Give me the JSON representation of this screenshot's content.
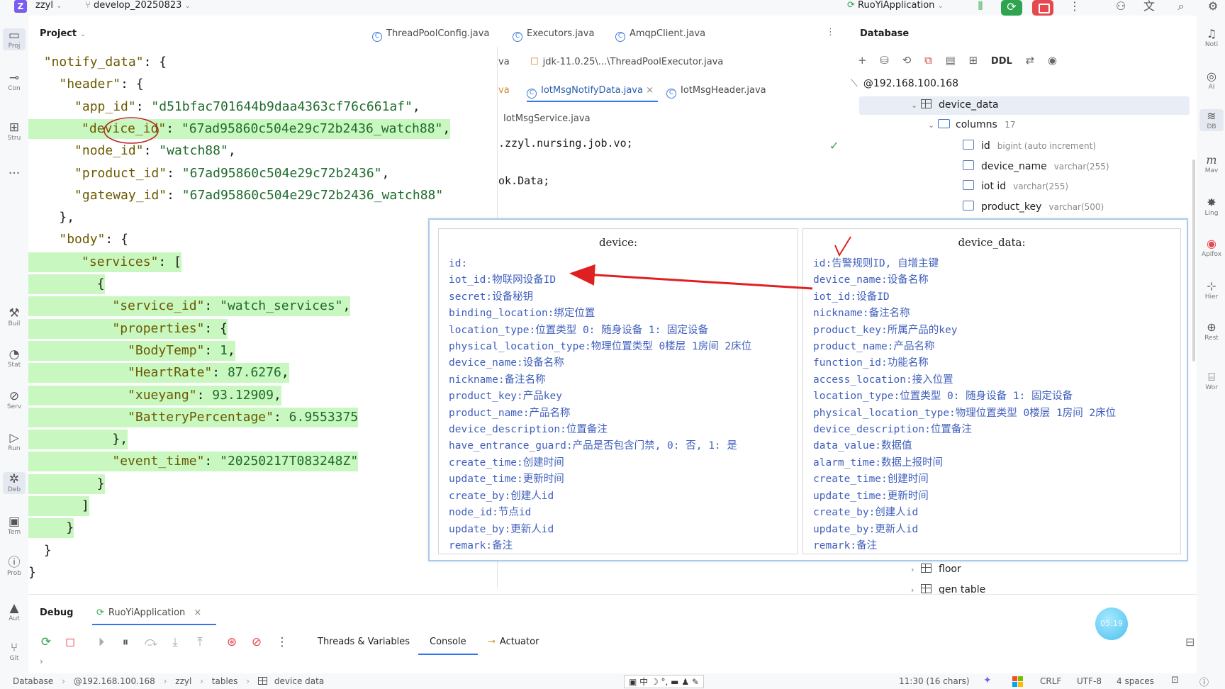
{
  "topbar": {
    "project_badge": "Z",
    "project_name": "zzyl",
    "branch": "develop_20250823",
    "run_config": "RuoYiApplication",
    "icons": [
      "branch-icon",
      "run-config-icon",
      "debug-icon",
      "run-icon",
      "stop-icon",
      "more-icon",
      "add-user-icon",
      "translate-icon",
      "search-icon",
      "settings-icon"
    ]
  },
  "left_strip": [
    {
      "label": "Proj",
      "icon": "folder-icon",
      "glyph": "▭"
    },
    {
      "label": "Con",
      "icon": "commit-icon",
      "glyph": "⊸"
    },
    {
      "label": "Stru",
      "icon": "structure-icon",
      "glyph": "⊞"
    },
    {
      "label": "...",
      "icon": "more-icon",
      "glyph": ""
    },
    {
      "label": "Buil",
      "icon": "build-icon",
      "glyph": "⚒"
    },
    {
      "label": "Stat",
      "icon": "stats-icon",
      "glyph": "◔"
    },
    {
      "label": "Serv",
      "icon": "services-icon",
      "glyph": "⊘"
    },
    {
      "label": "Run",
      "icon": "run-icon",
      "glyph": "▷"
    },
    {
      "label": "Deb",
      "icon": "debug-icon",
      "glyph": "✲"
    },
    {
      "label": "Tem",
      "icon": "terminal-icon",
      "glyph": "▣"
    },
    {
      "label": "Prob",
      "icon": "problems-icon",
      "glyph": "ⓘ"
    },
    {
      "label": "Aut",
      "icon": "warning-icon",
      "glyph": "▲"
    },
    {
      "label": "Git",
      "icon": "git-icon",
      "glyph": "⑂"
    }
  ],
  "right_strip": [
    {
      "label": "Noti",
      "icon": "notification-icon",
      "glyph": "♫"
    },
    {
      "label": "AI",
      "icon": "ai-icon",
      "glyph": "◎"
    },
    {
      "label": "DB",
      "icon": "database-icon",
      "glyph": "≋"
    },
    {
      "label": "Mav",
      "icon": "maven-icon",
      "glyph": "m"
    },
    {
      "label": "Ling",
      "icon": "lingma-icon",
      "glyph": "✸"
    },
    {
      "label": "Apifox",
      "icon": "apifox-icon",
      "glyph": "◉"
    },
    {
      "label": "Hier",
      "icon": "hierarchy-icon",
      "glyph": "⊹"
    },
    {
      "label": "Rest",
      "icon": "rest-icon",
      "glyph": "⊕"
    },
    {
      "label": "Wor",
      "icon": "word-icon",
      "glyph": "⌸"
    }
  ],
  "project_panel": {
    "title": "Project"
  },
  "editor_tabs_row1": [
    "ThreadPoolConfig.java",
    "Executors.java",
    "AmqpClient.java"
  ],
  "editor_tabs_row2": [
    "va",
    "jdk-11.0.25\\...\\ThreadPoolExecutor.java"
  ],
  "editor_tabs_row3": [
    "va",
    "IotMsgNotifyData.java",
    "IotMsgHeader.java"
  ],
  "editor_tabs_row4": [
    "IotMsgService.java"
  ],
  "code_lines": [
    ".zzyl.nursing.job.vo;",
    "ok.Data;"
  ],
  "json_view": {
    "lines": [
      {
        "indent": "  ",
        "key": "\"notify_data\"",
        "rest": ": {",
        "hl": false
      },
      {
        "indent": "    ",
        "key": "\"header\"",
        "rest": ": {",
        "hl": false
      },
      {
        "indent": "      ",
        "key": "\"app_id\"",
        "rest": ": ",
        "val": "\"d51bfac701644b9daa4363cf76c661af\"",
        "tail": ",",
        "hl": false
      },
      {
        "indent": "      ",
        "key": "\"device_id\"",
        "rest": ": ",
        "val": "\"67ad95860c504e29c72b2436_watch88\"",
        "tail": ",",
        "hl": true
      },
      {
        "indent": "      ",
        "key": "\"node_id\"",
        "rest": ": ",
        "val": "\"watch88\"",
        "tail": ",",
        "hl": false
      },
      {
        "indent": "      ",
        "key": "\"product_id\"",
        "rest": ": ",
        "val": "\"67ad95860c504e29c72b2436\"",
        "tail": ",",
        "hl": false
      },
      {
        "indent": "      ",
        "key": "\"gateway_id\"",
        "rest": ": ",
        "val": "\"67ad95860c504e29c72b2436_watch88\"",
        "tail": "",
        "hl": false
      },
      {
        "indent": "    ",
        "key": "",
        "rest": "},",
        "hl": false
      },
      {
        "indent": "    ",
        "key": "\"body\"",
        "rest": ": {",
        "hl": false
      },
      {
        "indent": "      ",
        "key": "\"services\"",
        "rest": ": [",
        "hl": true
      },
      {
        "indent": "        ",
        "key": "",
        "rest": "{",
        "hl": true
      },
      {
        "indent": "          ",
        "key": "\"service_id\"",
        "rest": ": ",
        "val": "\"watch_services\"",
        "tail": ",",
        "hl": true
      },
      {
        "indent": "          ",
        "key": "\"properties\"",
        "rest": ": {",
        "hl": true
      },
      {
        "indent": "            ",
        "key": "\"BodyTemp\"",
        "rest": ": ",
        "val": "1",
        "tail": ",",
        "hl": true
      },
      {
        "indent": "            ",
        "key": "\"HeartRate\"",
        "rest": ": ",
        "val": "87.6276",
        "tail": ",",
        "hl": true
      },
      {
        "indent": "            ",
        "key": "\"xueyang\"",
        "rest": ": ",
        "val": "93.12909",
        "tail": ",",
        "hl": true
      },
      {
        "indent": "            ",
        "key": "\"BatteryPercentage\"",
        "rest": ": ",
        "val": "6.9553375",
        "tail": "",
        "hl": true
      },
      {
        "indent": "          ",
        "key": "",
        "rest": "},",
        "hl": true
      },
      {
        "indent": "          ",
        "key": "\"event_time\"",
        "rest": ": ",
        "val": "\"20250217T083248Z\"",
        "tail": "",
        "hl": true
      },
      {
        "indent": "        ",
        "key": "",
        "rest": "}",
        "hl": true
      },
      {
        "indent": "      ",
        "key": "",
        "rest": "]",
        "hl": true
      },
      {
        "indent": "    ",
        "key": "",
        "rest": "}",
        "hl": true
      },
      {
        "indent": "  ",
        "key": "",
        "rest": "}",
        "hl": false
      },
      {
        "indent": "",
        "key": "",
        "rest": "}",
        "hl": false
      }
    ]
  },
  "database_panel": {
    "title": "Database",
    "toolbar": [
      "add-icon",
      "datasource-icon",
      "refresh-icon",
      "stop-icon",
      "console-icon",
      "table-icon",
      "DDL",
      "jump-icon",
      "eye-icon"
    ],
    "connection": "@192.168.100.168",
    "table": "device_data",
    "columns_label": "columns",
    "columns_count": "17",
    "columns": [
      {
        "name": "id",
        "type": "bigint (auto increment)"
      },
      {
        "name": "device_name",
        "type": "varchar(255)"
      },
      {
        "name": "iot id",
        "type": "varchar(255)"
      },
      {
        "name": "product_key",
        "type": "varchar(500)"
      }
    ],
    "more_tables": [
      "floor",
      "gen table"
    ]
  },
  "popup": {
    "left_title": "device:",
    "left_fields": [
      "id:",
      "iot_id:物联网设备ID",
      "secret:设备秘钥",
      "binding_location:绑定位置",
      "location_type:位置类型 0: 随身设备 1: 固定设备",
      "physical_location_type:物理位置类型 0楼层 1房间 2床位",
      "device_name:设备名称",
      "nickname:备注名称",
      "product_key:产品key",
      "product_name:产品名称",
      "device_description:位置备注",
      "have_entrance_guard:产品是否包含门禁, 0: 否, 1: 是",
      "create_time:创建时间",
      "update_time:更新时间",
      "create_by:创建人id",
      "node_id:节点id",
      "update_by:更新人id",
      "remark:备注"
    ],
    "right_title": "device_data:",
    "right_fields": [
      "id:告警规则ID, 自增主键",
      "device_name:设备名称",
      "iot_id:设备ID",
      "nickname:备注名称",
      "product_key:所属产品的key",
      "product_name:产品名称",
      "function_id:功能名称",
      "access_location:接入位置",
      "location_type:位置类型 0: 随身设备 1: 固定设备",
      "physical_location_type:物理位置类型 0楼层 1房间 2床位",
      "device_description:位置备注",
      "data_value:数据值",
      "alarm_time:数据上报时间",
      "create_time:创建时间",
      "update_time:更新时间",
      "create_by:创建人id",
      "update_by:更新人id",
      "remark:备注"
    ]
  },
  "debug_panel": {
    "tab_debug": "Debug",
    "run_config": "RuoYiApplication",
    "tabs": [
      "Threads & Variables",
      "Console",
      "Actuator"
    ],
    "timer": "05:19"
  },
  "status_bar": {
    "breadcrumbs": [
      "Database",
      "@192.168.100.168",
      "zzyl",
      "tables",
      "device data"
    ],
    "position": "11:30 (16 chars)",
    "line_ending": "CRLF",
    "encoding": "UTF-8",
    "indent": "4 spaces"
  },
  "colors": {
    "accent": "#3574f0",
    "highlight": "#c9f7c0",
    "annotation_red": "#e02020",
    "field_blue": "#3f5fbd"
  }
}
